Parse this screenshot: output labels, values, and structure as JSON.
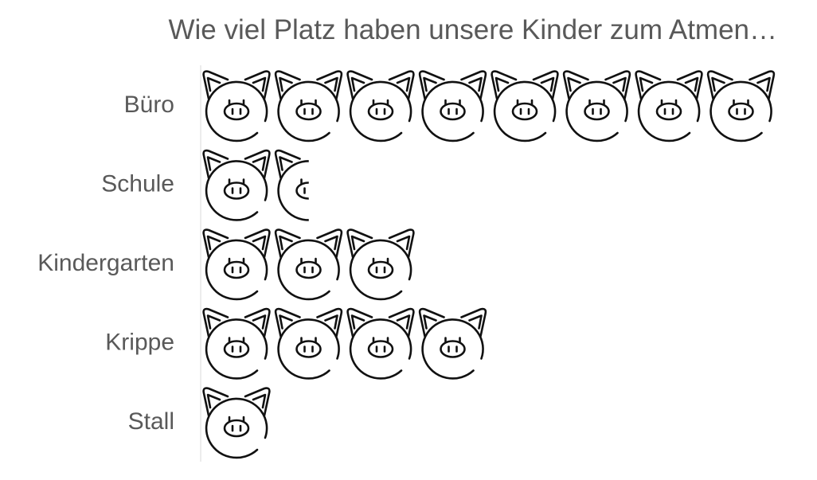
{
  "chart_data": {
    "type": "bar",
    "orientation": "horizontal",
    "title": "Wie viel Platz haben unsere Kinder zum Atmen…",
    "categories": [
      "Büro",
      "Schule",
      "Kindergarten",
      "Krippe",
      "Stall"
    ],
    "values": [
      8,
      1.5,
      3,
      4,
      1
    ],
    "marker_icon": "pig-face-icon",
    "xlabel": "",
    "ylabel": "",
    "grid": false,
    "legend": "none"
  }
}
